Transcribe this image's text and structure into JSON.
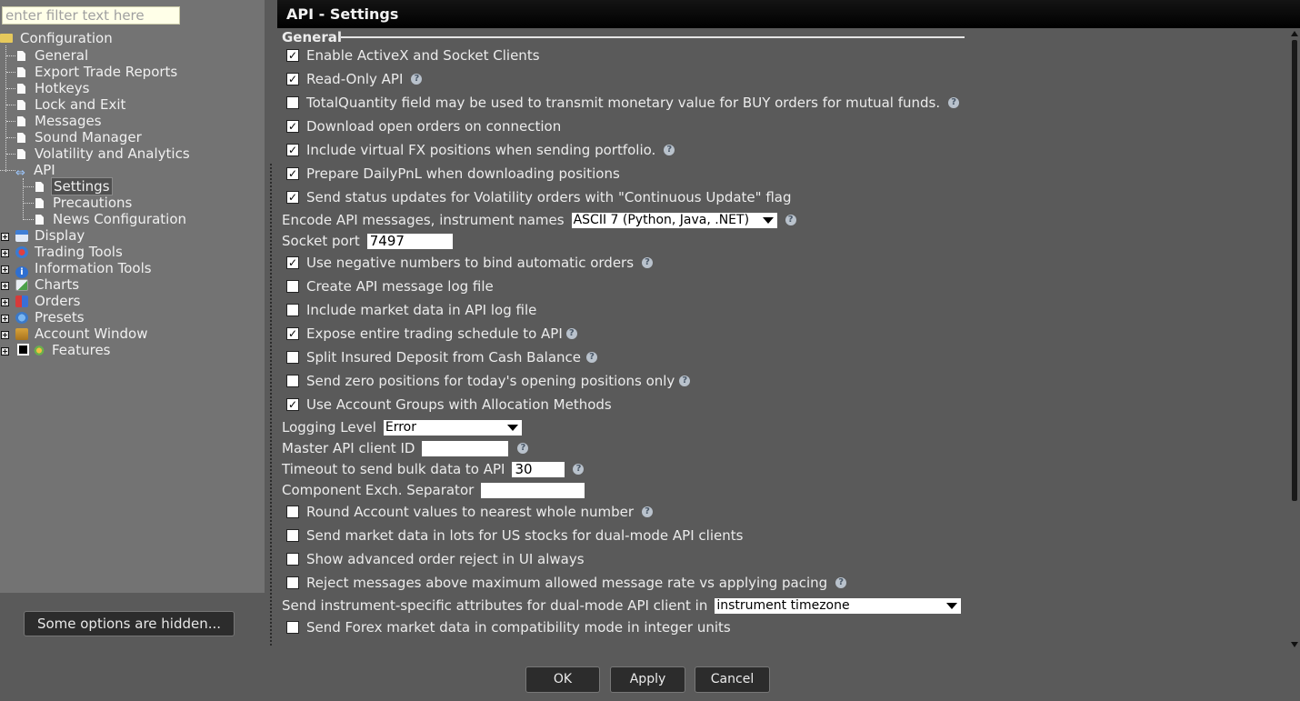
{
  "filter": {
    "placeholder": "enter filter text here"
  },
  "tree": {
    "root": "Configuration",
    "items": [
      {
        "label": "General"
      },
      {
        "label": "Export Trade Reports"
      },
      {
        "label": "Hotkeys"
      },
      {
        "label": "Lock and Exit"
      },
      {
        "label": "Messages"
      },
      {
        "label": "Sound Manager"
      },
      {
        "label": "Volatility and Analytics"
      },
      {
        "label": "API"
      },
      {
        "label": "Settings"
      },
      {
        "label": "Precautions"
      },
      {
        "label": "News Configuration"
      },
      {
        "label": "Display"
      },
      {
        "label": "Trading Tools"
      },
      {
        "label": "Information Tools"
      },
      {
        "label": "Charts"
      },
      {
        "label": "Orders"
      },
      {
        "label": "Presets"
      },
      {
        "label": "Account Window"
      },
      {
        "label": "Features"
      }
    ]
  },
  "hidden_options_label": "Some options are hidden...",
  "panel": {
    "title": "API - Settings",
    "section": "General",
    "options": [
      {
        "label": "Enable ActiveX and Socket Clients",
        "checked": true
      },
      {
        "label": "Read-Only API",
        "checked": true
      },
      {
        "label": "TotalQuantity field may be used to transmit monetary value for BUY orders for mutual funds.",
        "checked": false
      },
      {
        "label": "Download open orders on connection",
        "checked": true
      },
      {
        "label": "Include virtual FX positions when sending portfolio.",
        "checked": true
      },
      {
        "label": "Prepare DailyPnL when downloading positions",
        "checked": true
      },
      {
        "label": "Send status updates for Volatility orders with \"Continuous Update\" flag",
        "checked": true
      },
      {
        "label": "Use negative numbers to bind automatic orders",
        "checked": true
      },
      {
        "label": "Create API message log file",
        "checked": false
      },
      {
        "label": "Include market data in API log file",
        "checked": false
      },
      {
        "label": "Expose entire trading schedule to API",
        "checked": true
      },
      {
        "label": "Split Insured Deposit from Cash Balance",
        "checked": false
      },
      {
        "label": "Send zero positions for today's opening positions only",
        "checked": false
      },
      {
        "label": "Use Account Groups with Allocation Methods",
        "checked": true
      },
      {
        "label": "Round Account values to nearest whole number",
        "checked": false
      },
      {
        "label": "Send market data in lots for US stocks for dual-mode API clients",
        "checked": false
      },
      {
        "label": "Show advanced order reject in UI always",
        "checked": false
      },
      {
        "label": "Reject messages above maximum allowed message rate vs applying pacing",
        "checked": false
      },
      {
        "label": "Send Forex market data in compatibility mode in integer units",
        "checked": false
      }
    ],
    "encode": {
      "label": "Encode API messages, instrument names",
      "value": "ASCII 7 (Python, Java, .NET)"
    },
    "socket_port": {
      "label": "Socket port",
      "value": "7497"
    },
    "logging_level": {
      "label": "Logging Level",
      "value": "Error"
    },
    "master_client_id": {
      "label": "Master API client ID",
      "value": ""
    },
    "timeout": {
      "label": "Timeout to send bulk data to API",
      "value": "30"
    },
    "separator": {
      "label": "Component Exch. Separator",
      "value": ""
    },
    "instrument_attrs": {
      "label": "Send instrument-specific attributes for dual-mode API client in",
      "value": "instrument timezone"
    }
  },
  "buttons": {
    "ok": "OK",
    "apply": "Apply",
    "cancel": "Cancel"
  },
  "icons": {
    "help": "help-icon",
    "check": "✓"
  },
  "colors": {
    "background": "#5a5a5a",
    "tree_background": "#737373",
    "title_bar": "#000000"
  }
}
